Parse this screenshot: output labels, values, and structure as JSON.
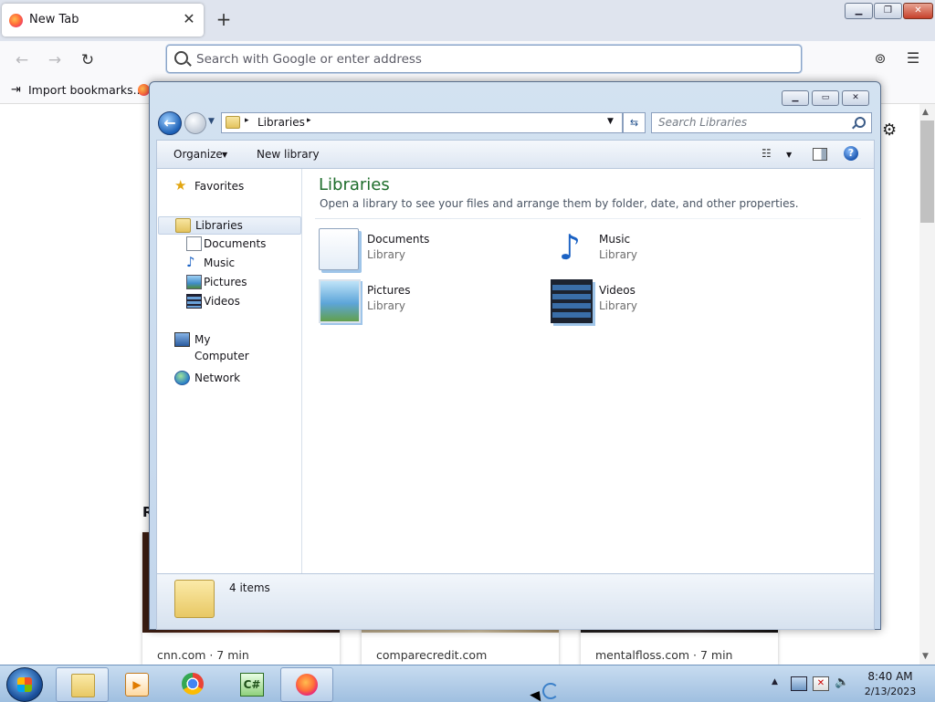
{
  "firefox": {
    "tab_title": "New Tab",
    "tab_close": "✕",
    "new_tab": "+",
    "window_buttons": {
      "minimize": "▁",
      "maximize": "❐",
      "close": "✕"
    },
    "nav": {
      "back": "←",
      "forward": "→",
      "reload": "↻"
    },
    "url_placeholder": "Search with Google or enter address",
    "toolbar_icons": {
      "pocket": "pocket-icon",
      "menu": "hamburger-menu-icon"
    },
    "pocket_glyph": "⊚",
    "menu_glyph": "☰",
    "bookmarks_bar": {
      "import_glyph": "⇥",
      "import_label": "Import bookmarks..."
    },
    "settings_glyph": "⚙",
    "section_heading": "R",
    "stories": [
      {
        "source": "cnn.com · 7 min"
      },
      {
        "source": "comparecredit.com"
      },
      {
        "source": "mentalfloss.com · 7 min"
      }
    ],
    "scrollbar": {
      "up": "▲",
      "down": "▼"
    }
  },
  "explorer": {
    "window_buttons": {
      "minimize": "▁",
      "maximize": "▭",
      "close": "✕"
    },
    "back_glyph": "←",
    "recent_glyph": "▼",
    "address": {
      "sep": "▸",
      "location": "Libraries",
      "dropdown": "▼"
    },
    "refresh_glyph": "⇆",
    "search_placeholder": "Search Libraries",
    "toolbar": {
      "organize": "Organize",
      "organize_arrow": "▼",
      "new_library": "New library",
      "views_glyph": "☷",
      "views_arrow": "▼",
      "help_glyph": "?"
    },
    "nav_pane": {
      "favorites": "Favorites",
      "favorites_glyph": "★",
      "libraries": "Libraries",
      "library_items": [
        "Documents",
        "Music",
        "Pictures",
        "Videos"
      ],
      "music_glyph": "♪",
      "my_computer": "My Computer",
      "network": "Network"
    },
    "content": {
      "title": "Libraries",
      "description": "Open a library to see your files and arrange them by folder, date, and other properties.",
      "libraries": [
        {
          "name": "Documents",
          "type": "Library"
        },
        {
          "name": "Music",
          "type": "Library"
        },
        {
          "name": "Pictures",
          "type": "Library"
        },
        {
          "name": "Videos",
          "type": "Library"
        }
      ],
      "music_glyph": "♪"
    },
    "status": {
      "items": "4 items"
    }
  },
  "taskbar": {
    "apps": [
      "windows-explorer",
      "windows-media-player",
      "google-chrome",
      "csharp-ide",
      "firefox"
    ],
    "wmp_glyph": "▶",
    "csharp_glyph": "C#",
    "tray": {
      "show_hidden": "▲",
      "flag_glyph": "✕",
      "volume_glyph": "🔈"
    },
    "clock": {
      "time": "8:40 AM",
      "date": "2/13/2023"
    }
  },
  "colors": {
    "firefox_tabstrip": "#dfe4ee",
    "explorer_frame": "#c3d6ec",
    "library_title": "#1e6d2b",
    "taskbar": "#9fbfe0"
  }
}
